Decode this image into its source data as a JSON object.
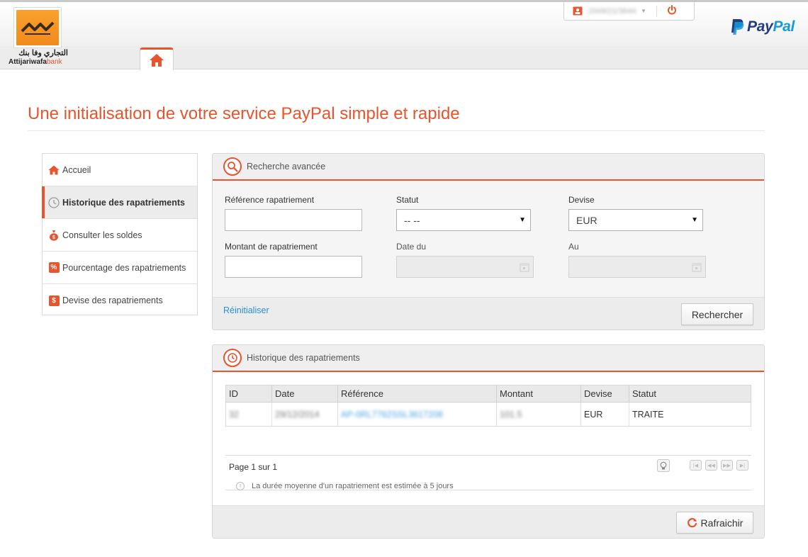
{
  "header": {
    "logo_ar": "التجاري وفا بنك",
    "logo_name": "Attijariwafa",
    "logo_bank": "bank",
    "user_id": "2009/21/3644",
    "paypal_pay": "Pay",
    "paypal_pal": "Pal"
  },
  "page_title": "Une initialisation de votre service PayPal simple et rapide",
  "sidebar": {
    "items": [
      {
        "label": "Accueil"
      },
      {
        "label": "Historique des rapatriements"
      },
      {
        "label": "Consulter les soldes"
      },
      {
        "label": "Pourcentage des rapatriements",
        "badge": "%"
      },
      {
        "label": "Devise des rapatriements",
        "badge": "$"
      }
    ]
  },
  "search": {
    "title": "Recherche avancée",
    "ref_label": "Référence rapatriement",
    "statut_label": "Statut",
    "statut_value": "-- --",
    "devise_label": "Devise",
    "devise_value": "EUR",
    "montant_label": "Montant de rapatriement",
    "date_from_label": "Date du",
    "date_to_label": "Au",
    "reset_label": "Réinitialiser",
    "search_button": "Rechercher"
  },
  "history": {
    "title": "Historique des rapatriements",
    "columns": [
      "ID",
      "Date",
      "Référence",
      "Montant",
      "Devise",
      "Statut"
    ],
    "rows": [
      {
        "id": "32",
        "date": "29/12/2014",
        "reference": "AP-0RL7762SSL3617208",
        "montant": "101.5",
        "devise": "EUR",
        "statut": "TRAITE"
      }
    ],
    "pager_text": "Page 1 sur 1",
    "info_text": "La durée moyenne d'un rapatriement est estimée à 5 jours",
    "refresh_button": "Rafraichir"
  },
  "colors": {
    "accent": "#e8542d",
    "link": "#2a8fd1",
    "paypal_dark": "#253b80",
    "paypal_light": "#179bd7"
  }
}
